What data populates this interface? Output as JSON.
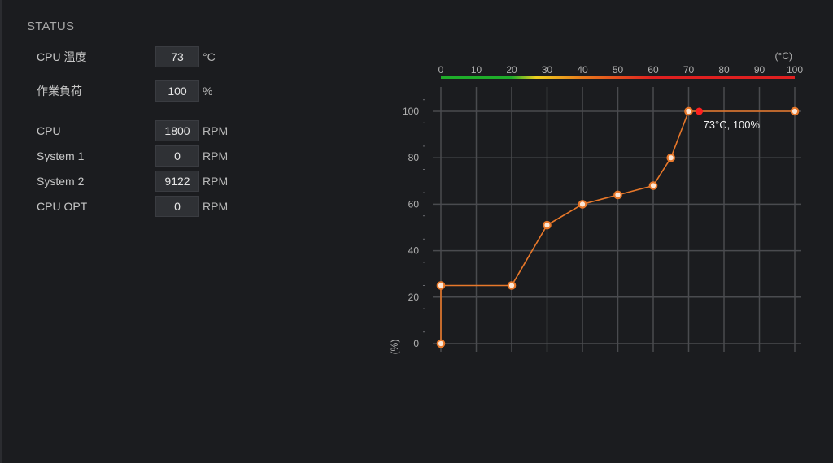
{
  "status": {
    "title": "STATUS",
    "cpu_temp": {
      "label": "CPU 溫度",
      "value": "73",
      "unit": "°C"
    },
    "work_load": {
      "label": "作業負荷",
      "value": "100",
      "unit": "%"
    },
    "fans": [
      {
        "label": "CPU",
        "value": "1800",
        "unit": "RPM"
      },
      {
        "label": "System 1",
        "value": "0",
        "unit": "RPM"
      },
      {
        "label": "System 2",
        "value": "9122",
        "unit": "RPM"
      },
      {
        "label": "CPU OPT",
        "value": "0",
        "unit": "RPM"
      }
    ]
  },
  "chart_data": {
    "type": "line",
    "x_unit_label": "(°C)",
    "y_unit_label": "(%)",
    "xlim": [
      0,
      100
    ],
    "ylim": [
      0,
      100
    ],
    "x_ticks": [
      "0",
      "10",
      "20",
      "30",
      "40",
      "50",
      "60",
      "70",
      "80",
      "90",
      "100"
    ],
    "y_ticks": [
      "0",
      "20",
      "40",
      "60",
      "80",
      "100"
    ],
    "series": [
      {
        "x": [
          0,
          0,
          20,
          30,
          40,
          50,
          60,
          65,
          70,
          100
        ],
        "y": [
          0,
          25,
          25,
          51,
          60,
          64,
          68,
          80,
          100,
          100
        ],
        "color": "#e8782a"
      }
    ],
    "current_point": {
      "x": 73,
      "y": 100,
      "label": "73°C, 100%",
      "color": "#ff2020"
    },
    "temp_bar_stops": [
      {
        "x": 0,
        "color": "#1fae2a"
      },
      {
        "x": 20,
        "color": "#1fae2a"
      },
      {
        "x": 27,
        "color": "#f0d020"
      },
      {
        "x": 40,
        "color": "#e87a1c"
      },
      {
        "x": 60,
        "color": "#e02020"
      },
      {
        "x": 100,
        "color": "#e02020"
      }
    ],
    "grid": true
  }
}
